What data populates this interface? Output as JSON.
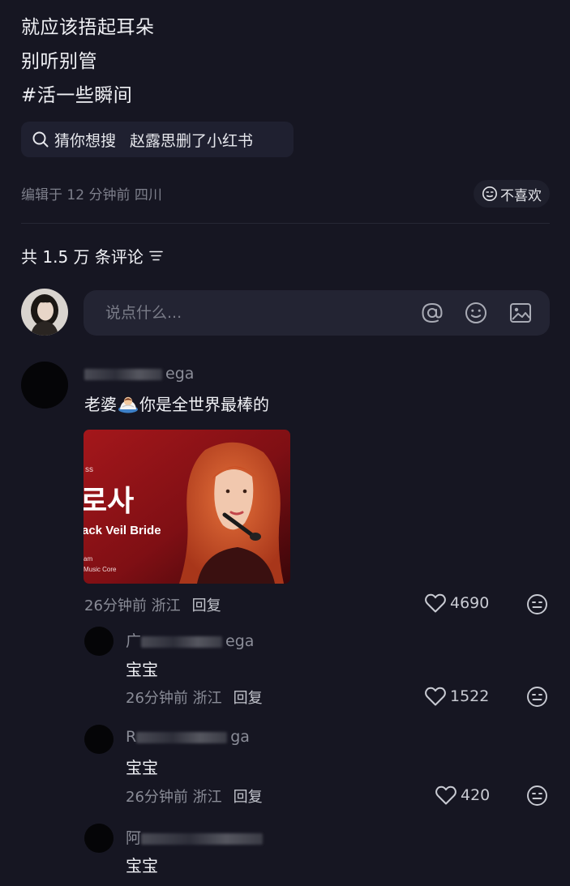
{
  "post": {
    "caption_lines": [
      "就应该捂起耳朵",
      "别听别管",
      "#活一些瞬间"
    ],
    "search": {
      "label": "猜你想搜",
      "query": "赵露思删了小红书"
    },
    "meta": "编辑于 12 分钟前 四川",
    "dislike_label": "不喜欢"
  },
  "comments_header": {
    "count_text": "共 1.5 万 条评论"
  },
  "comment_input": {
    "placeholder": "说点什么..."
  },
  "comments": [
    {
      "username_visible": "ega",
      "text": "老婆",
      "text_after_emoji": "你是全世界最棒的",
      "image": {
        "korean_title": "로사",
        "english_title": "ack Veil Bride",
        "line_a": "ss",
        "line_b": "am",
        "line_c": "Music Core"
      },
      "time_location": "26分钟前 浙江",
      "reply_label": "回复",
      "likes": "4690"
    }
  ],
  "replies": [
    {
      "username_prefix": "广",
      "username_visible": "ega",
      "text": "宝宝",
      "time_location": "26分钟前 浙江",
      "reply_label": "回复",
      "likes": "1522"
    },
    {
      "username_prefix": "R",
      "username_visible": "ga",
      "text": "宝宝",
      "time_location": "26分钟前 浙江",
      "reply_label": "回复",
      "likes": "420"
    },
    {
      "username_prefix": "阿",
      "username_visible": "",
      "text": "宝宝"
    }
  ]
}
